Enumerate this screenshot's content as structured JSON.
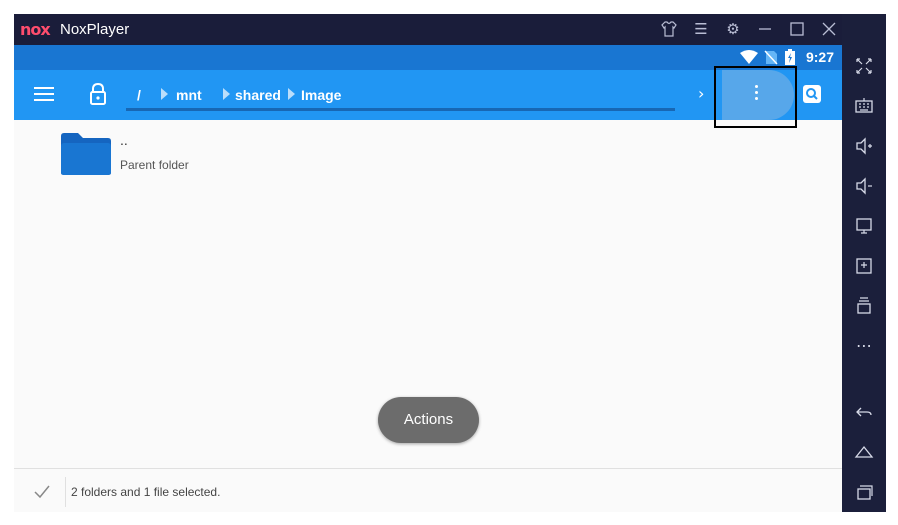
{
  "window": {
    "logo_text": "nox",
    "title": "NoxPlayer"
  },
  "statusbar": {
    "time": "9:27"
  },
  "toolbar": {
    "breadcrumbs": [
      {
        "label": "/"
      },
      {
        "label": "mnt"
      },
      {
        "label": "shared"
      },
      {
        "label": "Image"
      }
    ]
  },
  "file_list": {
    "items": [
      {
        "name": "..",
        "description": "Parent folder",
        "icon": "folder-icon"
      }
    ]
  },
  "fab": {
    "label": "Actions"
  },
  "bottom_bar": {
    "status": "2 folders and 1 file selected."
  },
  "colors": {
    "toolbar": "#2196f3",
    "statusbar": "#1976d2",
    "window_frame": "#1b1f3b",
    "folder": "#1565c0",
    "fab": "#6c6c6c"
  },
  "titlebar_icons": [
    "shirt-icon",
    "menu-icon",
    "settings-icon",
    "minimize-icon",
    "maximize-icon",
    "close-icon",
    "collapse-sidebar-icon"
  ],
  "sidebar_icons": [
    "fullscreen-icon",
    "keyboard-icon",
    "volume-up-icon",
    "volume-down-icon",
    "screen-icon",
    "apk-install-icon",
    "multi-instance-icon",
    "more-icon",
    "back-icon",
    "home-icon",
    "recents-icon"
  ]
}
